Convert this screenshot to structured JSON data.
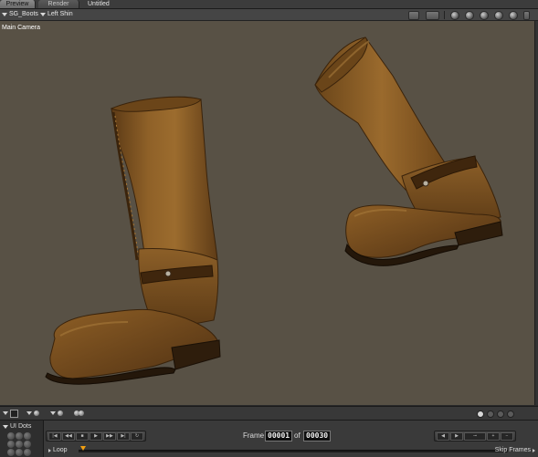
{
  "tabs": [
    {
      "label": "Preview",
      "active": true
    },
    {
      "label": "Render",
      "active": false
    }
  ],
  "document": {
    "title": "Untitled"
  },
  "viewport_header": {
    "figure_select": "SG_Boots",
    "actor_select": "Left Shin"
  },
  "viewport": {
    "camera_label": "Main Camera",
    "background_color": "#585145",
    "subject": "pair of brown leather boots"
  },
  "bottom_bar": {
    "page_dots": [
      true,
      false,
      false,
      false
    ]
  },
  "ui_dots": {
    "title": "UI Dots"
  },
  "animation": {
    "frame_label": "Frame",
    "current_frame": "00001",
    "of_label": "of",
    "total_frames": "00030",
    "loop_label": "Loop",
    "skip_frames_label": "Skip Frames"
  },
  "icons": [
    "preview-dropdown-icon",
    "display-style-icon",
    "render-ball-icon",
    "transport-controls",
    "keyframe-controls",
    "play-marker-icon"
  ],
  "colors": {
    "accent_marker": "#f2a012"
  }
}
